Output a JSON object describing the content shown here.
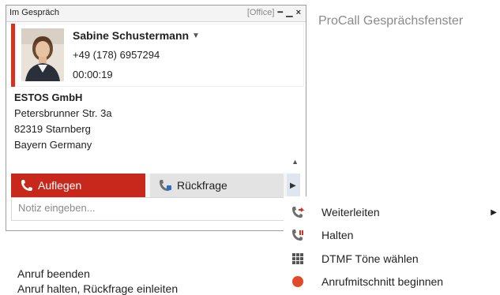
{
  "window": {
    "title": "Im Gespräch",
    "office_tag": "[Office]",
    "controls": {
      "pin": "━",
      "minimize": "▁",
      "close": "×"
    }
  },
  "contact": {
    "name": "Sabine Schustermann",
    "phone": "+49 (178) 6957294",
    "duration": "00:00:19"
  },
  "card": {
    "company": "ESTOS GmbH",
    "street": "Petersbrunner Str. 3a",
    "city": "82319 Starnberg",
    "region": "Bayern Germany"
  },
  "buttons": {
    "hangup": "Auflegen",
    "consult": "Rückfrage"
  },
  "note": {
    "placeholder": "Notiz eingeben..."
  },
  "caption": "ProCall Gesprächsfenster",
  "menu": {
    "items": [
      {
        "label": "Weiterleiten",
        "icon": "forward-icon",
        "has_submenu": true
      },
      {
        "label": "Halten",
        "icon": "hold-icon",
        "has_submenu": false
      },
      {
        "label": "DTMF Töne wählen",
        "icon": "dtmf-keypad-icon",
        "has_submenu": false
      },
      {
        "label": "Anrufmitschnitt beginnen",
        "icon": "record-icon",
        "has_submenu": false
      }
    ]
  },
  "descriptions": {
    "line1": "Anruf beenden",
    "line2": "Anruf halten, Rückfrage einleiten"
  },
  "colors": {
    "accent_red": "#c8281c",
    "stripe_red": "#d8321f",
    "record_red": "#e04a2a"
  }
}
